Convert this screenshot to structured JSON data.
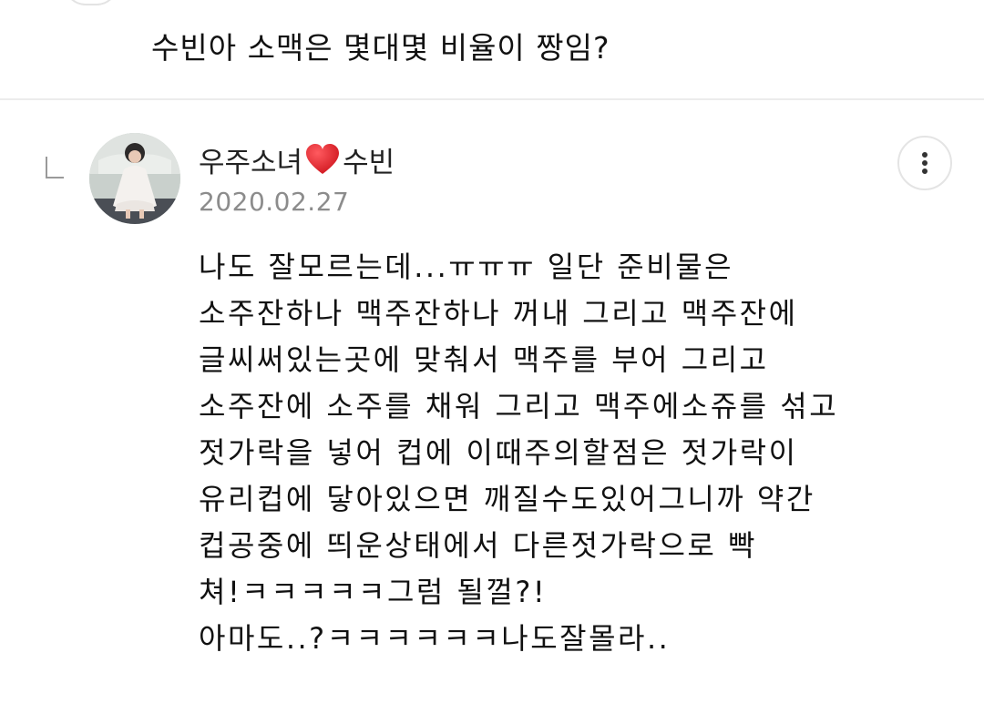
{
  "post": {
    "question": "수빈아 소맥은 몇대몇 비율이 짱임?"
  },
  "reply": {
    "author_prefix": "우주소녀",
    "author_icon": "heart-icon",
    "author_suffix": "수빈",
    "date": "2020.02.27",
    "more_icon": "more-vertical-icon",
    "body_lines": [
      "나도 잘모르는데...ㅠㅠㅠ 일단 준비물은",
      "소주잔하나 맥주잔하나 꺼내 그리고 맥주잔에",
      "글씨써있는곳에 맞춰서 맥주를 부어 그리고",
      "소주잔에 소주를 채워 그리고 맥주에소쥬를 섞고",
      "젓가락을 넣어 컵에 이때주의할점은 젓가락이",
      "유리컵에 닿아있으면 깨질수도있어그니까 약간",
      "컵공중에 띄운상태에서 다른젓가락으로 빡",
      "쳐!ㅋㅋㅋㅋㅋ그럼 될껄?!",
      "아마도..?ㅋㅋㅋㅋㅋㅋ나도잘몰라.."
    ]
  },
  "colors": {
    "heart": "#e0242b",
    "date": "#8c8c8c",
    "divider": "#ececec"
  }
}
